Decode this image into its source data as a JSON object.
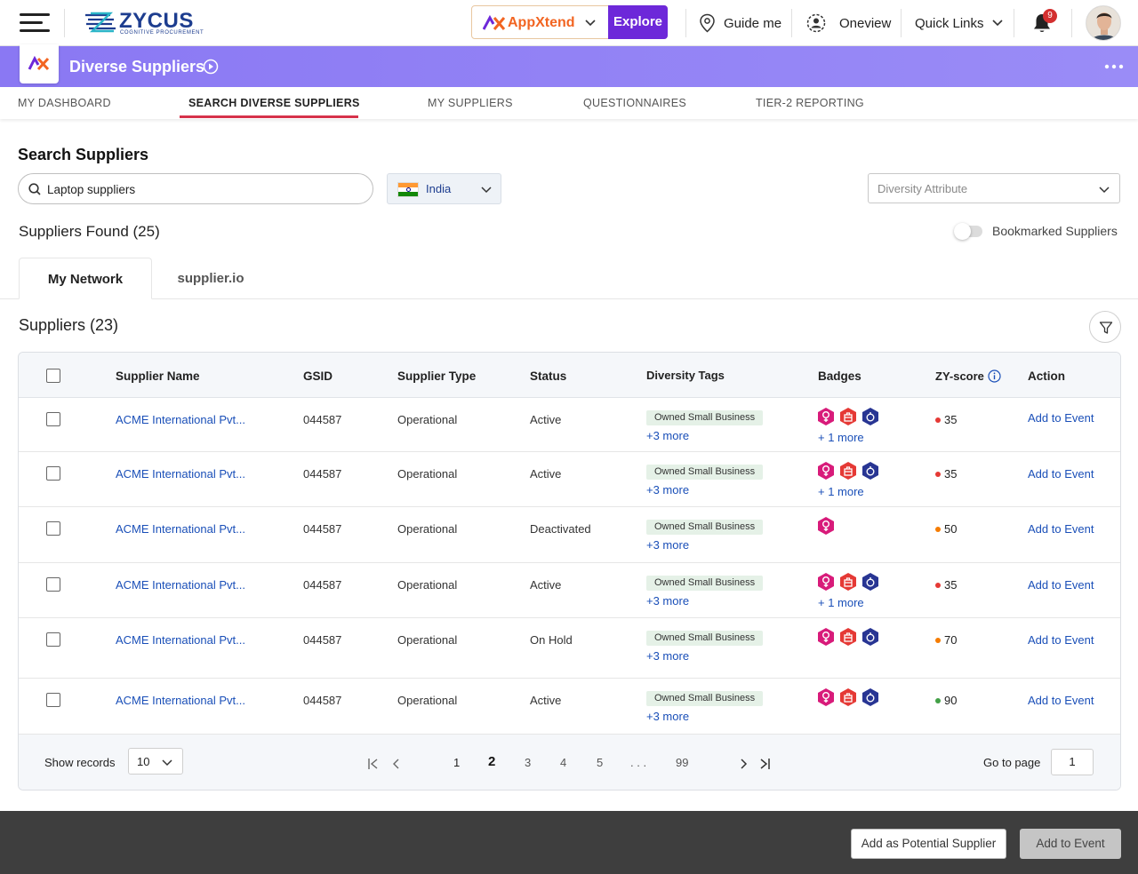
{
  "topbar": {
    "brand": "ZYCUS",
    "brand_sub": "COGNITIVE PROCUREMENT",
    "appxtend": "AppXtend",
    "explore": "Explore",
    "guide_me": "Guide me",
    "oneview": "Oneview",
    "quick_links": "Quick Links",
    "notifications_count": "9"
  },
  "appbar": {
    "title": "Diverse Suppliers"
  },
  "nav": {
    "tabs": [
      {
        "label": "MY DASHBOARD"
      },
      {
        "label": "SEARCH DIVERSE SUPPLIERS"
      },
      {
        "label": "MY SUPPLIERS"
      },
      {
        "label": "QUESTIONNAIRES"
      },
      {
        "label": "TIER-2 REPORTING"
      }
    ],
    "active_index": 1
  },
  "search": {
    "heading": "Search Suppliers",
    "value": "Laptop suppliers",
    "country": "India",
    "diversity_placeholder": "Diversity Attribute"
  },
  "results": {
    "found_label": "Suppliers Found (25)",
    "bookmarked_label": "Bookmarked Suppliers",
    "bookmarked_on": false,
    "subtabs": [
      {
        "label": "My Network"
      },
      {
        "label": "supplier.io"
      }
    ],
    "suppliers_heading": "Suppliers (23)"
  },
  "table": {
    "columns": {
      "name": "Supplier Name",
      "gsid": "GSID",
      "type": "Supplier Type",
      "status": "Status",
      "tags": "Diversity Tags",
      "badges": "Badges",
      "score": "ZY-score",
      "action": "Action"
    },
    "rows": [
      {
        "name": "ACME International Pvt...",
        "gsid": "044587",
        "type": "Operational",
        "status": "Active",
        "tag": "Owned Small Business",
        "tag_more": "+3 more",
        "badges": [
          "female-owned",
          "minority-owned",
          "veteran-owned"
        ],
        "badge_more": "+ 1 more",
        "score": "35",
        "score_color": "#e53935",
        "action": "Add to Event"
      },
      {
        "name": "ACME International Pvt...",
        "gsid": "044587",
        "type": "Operational",
        "status": "Active",
        "tag": "Owned Small Business",
        "tag_more": "+3 more",
        "badges": [
          "female-owned",
          "minority-owned",
          "veteran-owned"
        ],
        "badge_more": "+ 1 more",
        "score": "35",
        "score_color": "#e53935",
        "action": "Add to Event"
      },
      {
        "name": "ACME International Pvt...",
        "gsid": "044587",
        "type": "Operational",
        "status": "Deactivated",
        "tag": "Owned Small Business",
        "tag_more": "+3 more",
        "badges": [
          "female-owned"
        ],
        "badge_more": "",
        "score": "50",
        "score_color": "#f57c00",
        "action": "Add to Event"
      },
      {
        "name": "ACME International Pvt...",
        "gsid": "044587",
        "type": "Operational",
        "status": "Active",
        "tag": "Owned Small Business",
        "tag_more": "+3 more",
        "badges": [
          "female-owned",
          "minority-owned",
          "veteran-owned"
        ],
        "badge_more": "+ 1 more",
        "score": "35",
        "score_color": "#e53935",
        "action": "Add to Event"
      },
      {
        "name": "ACME International Pvt...",
        "gsid": "044587",
        "type": "Operational",
        "status": "On Hold",
        "tag": "Owned Small Business",
        "tag_more": "+3 more",
        "badges": [
          "female-owned",
          "minority-owned",
          "veteran-owned"
        ],
        "badge_more": "",
        "score": "70",
        "score_color": "#f57c00",
        "action": "Add to Event"
      },
      {
        "name": "ACME International Pvt...",
        "gsid": "044587",
        "type": "Operational",
        "status": "Active",
        "tag": "Owned Small Business",
        "tag_more": "+3 more",
        "badges": [
          "female-owned",
          "minority-owned",
          "veteran-owned"
        ],
        "badge_more": "",
        "score": "90",
        "score_color": "#43a047",
        "action": "Add to Event"
      }
    ]
  },
  "pagination": {
    "show_records_label": "Show records",
    "records_per_page": "10",
    "pages": [
      "1",
      "2",
      "3",
      "4",
      "5",
      ". . .",
      "99"
    ],
    "current_page": "2",
    "goto_label": "Go to page",
    "goto_value": "1"
  },
  "footer": {
    "add_potential": "Add as Potential Supplier",
    "add_event": "Add to Event"
  },
  "colors": {
    "accent_purple": "#6d28d9",
    "appbar": "#8b7cf6",
    "link": "#1a4fb8",
    "tab_underline": "#d6324a"
  }
}
